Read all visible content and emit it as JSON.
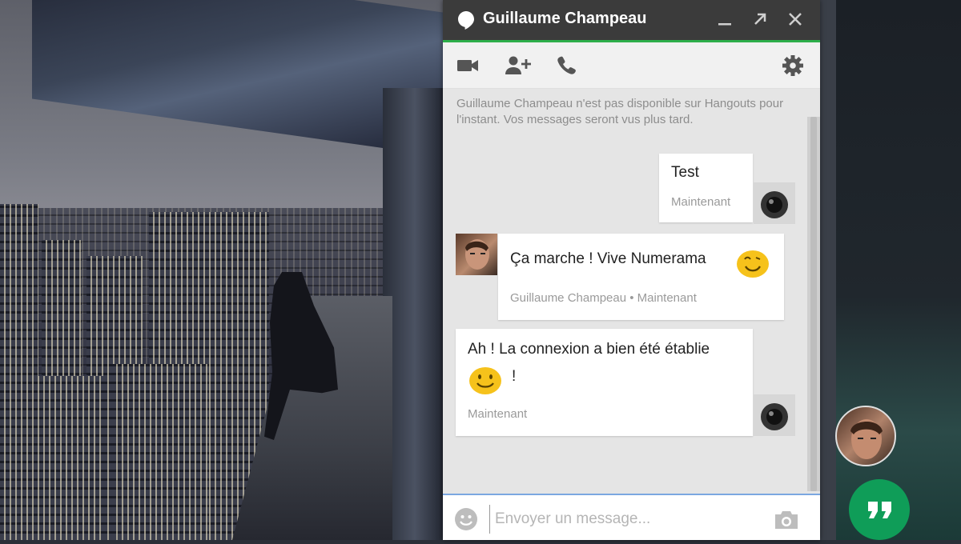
{
  "window": {
    "title": "Guillaume Champeau",
    "accent_color": "#2dae4a"
  },
  "toolbar": {
    "icons": [
      "video-icon",
      "add-person-icon",
      "phone-icon",
      "settings-icon"
    ]
  },
  "chat": {
    "notice": "Guillaume Champeau n'est pas disponible sur Hangouts pour l'instant. Vos messages seront vus plus tard.",
    "messages": [
      {
        "text": "Test",
        "meta": "Maintenant"
      },
      {
        "text": "Ça marche ! Vive Numerama",
        "meta": "Guillaume Champeau • Maintenant"
      },
      {
        "text": "Ah ! La connexion a bien été établie",
        "text2": "!",
        "meta": "Maintenant"
      }
    ]
  },
  "composer": {
    "placeholder": "Envoyer un message..."
  },
  "fab": {
    "icon": "quote-icon",
    "color": "#0f9d58"
  }
}
